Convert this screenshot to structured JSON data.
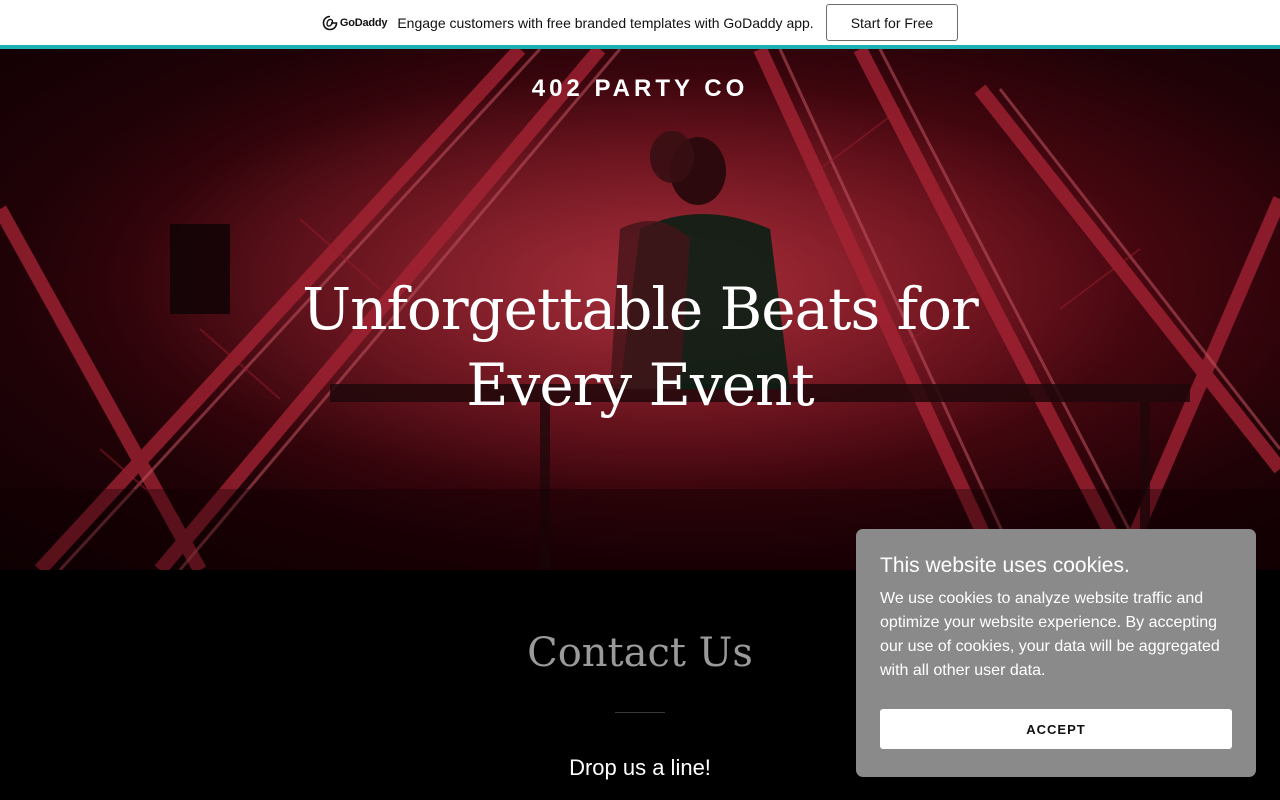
{
  "promo": {
    "logo_text": "GoDaddy",
    "message": "Engage customers with free branded templates with GoDaddy app.",
    "cta_label": "Start for Free",
    "accent_color": "#1bb0b3"
  },
  "hero": {
    "site_title": "402 PARTY CO",
    "headline_line1": "Unforgettable Beats for",
    "headline_line2": "Every Event",
    "image_icon": "dj-stage-photo"
  },
  "contact": {
    "title": "Contact Us",
    "subtitle": "Drop us a line!"
  },
  "cookie": {
    "title": "This website uses cookies.",
    "message": "We use cookies to analyze website traffic and optimize your website experience. By accepting our use of cookies, your data will be aggregated with all other user data.",
    "accept_label": "ACCEPT",
    "background_color": "#8a8a8a"
  }
}
